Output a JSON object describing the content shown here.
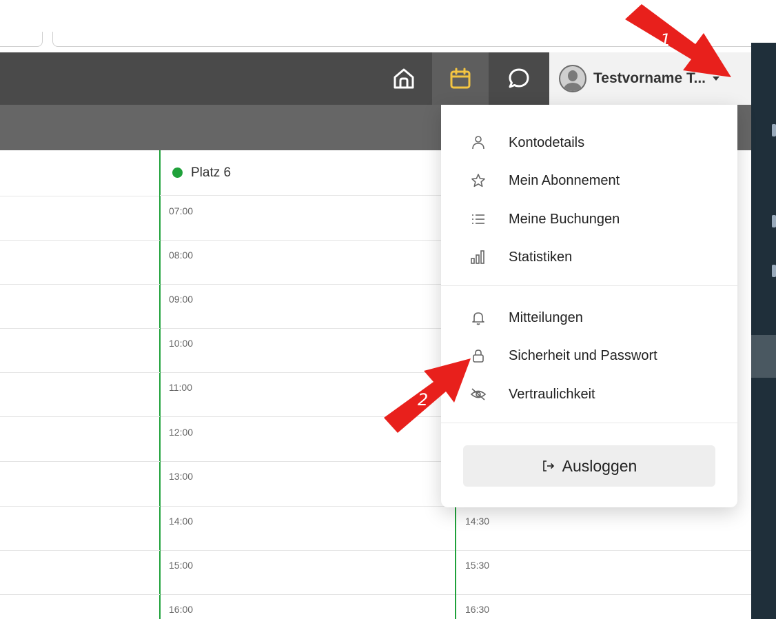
{
  "nav": {
    "icons": [
      "home-icon",
      "calendar-icon",
      "chat-icon"
    ],
    "user_name": "Testvorname T...",
    "active_color": "#f4c542"
  },
  "court": {
    "name": "Platz 6",
    "status_color": "#1fa13a"
  },
  "times_left": [
    "07:00",
    "08:00",
    "09:00",
    "10:00",
    "11:00",
    "12:00",
    "13:00",
    "14:00",
    "15:00",
    "16:00"
  ],
  "times_right": [
    "14:30",
    "15:30",
    "16:30"
  ],
  "menu": {
    "group1": [
      {
        "label": "Kontodetails",
        "icon": "user-icon"
      },
      {
        "label": "Mein Abonnement",
        "icon": "star-icon"
      },
      {
        "label": "Meine Buchungen",
        "icon": "list-icon"
      },
      {
        "label": "Statistiken",
        "icon": "bar-chart-icon"
      }
    ],
    "group2": [
      {
        "label": "Mitteilungen",
        "icon": "bell-icon"
      },
      {
        "label": "Sicherheit und Passwort",
        "icon": "lock-icon"
      },
      {
        "label": "Vertraulichkeit",
        "icon": "eye-off-icon"
      }
    ],
    "logout_label": "Ausloggen"
  },
  "annotations": {
    "arrow1": "1",
    "arrow2": "2",
    "color": "#e8201c"
  }
}
